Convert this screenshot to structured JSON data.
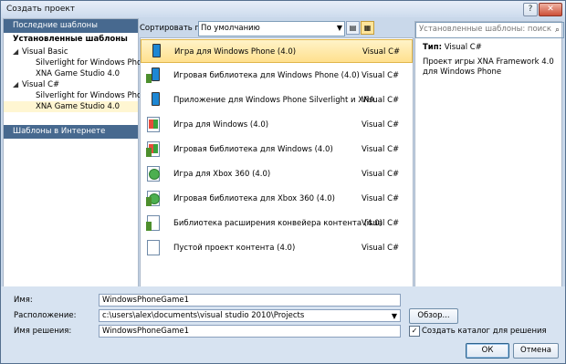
{
  "window": {
    "title": "Создать проект",
    "help": "?",
    "close": "✕"
  },
  "left_panel": {
    "recent": "Последние шаблоны",
    "installed": "Установленные шаблоны",
    "tree": [
      {
        "label": "Visual Basic",
        "children": [
          "Silverlight for Windows Phone",
          "XNA Game Studio 4.0"
        ]
      },
      {
        "label": "Visual C#",
        "children": [
          "Silverlight for Windows Phone",
          "XNA Game Studio 4.0"
        ]
      }
    ],
    "online": "Шаблоны в Интернете"
  },
  "toolbar": {
    "sort_label": "Сортировать по:",
    "sort_value": "По умолчанию"
  },
  "templates": [
    {
      "name": "Игра для Windows Phone (4.0)",
      "lang": "Visual C#",
      "icon": "phone-icon",
      "selected": true
    },
    {
      "name": "Игровая библиотека для Windows Phone (4.0)",
      "lang": "Visual C#",
      "icon": "phone-library-icon"
    },
    {
      "name": "Приложение для Windows Phone Silverlight и XNA",
      "lang": "Visual C#",
      "icon": "phone-app-icon"
    },
    {
      "name": "Игра для Windows (4.0)",
      "lang": "Visual C#",
      "icon": "windows-game-icon"
    },
    {
      "name": "Игровая библиотека для Windows (4.0)",
      "lang": "Visual C#",
      "icon": "windows-library-icon"
    },
    {
      "name": "Игра для Xbox 360 (4.0)",
      "lang": "Visual C#",
      "icon": "xbox-game-icon"
    },
    {
      "name": "Игровая библиотека для Xbox 360 (4.0)",
      "lang": "Visual C#",
      "icon": "xbox-library-icon"
    },
    {
      "name": "Библиотека расширения конвейера контента (4.0)",
      "lang": "Visual C#",
      "icon": "content-pipeline-icon"
    },
    {
      "name": "Пустой проект контента (4.0)",
      "lang": "Visual C#",
      "icon": "content-project-icon"
    }
  ],
  "details": {
    "search_placeholder": "Установленные шаблоны: поиск",
    "type_label": "Тип:",
    "type_value": "Visual C#",
    "description": "Проект игры XNA Framework 4.0 для Windows Phone"
  },
  "form": {
    "name_label": "Имя:",
    "name_value": "WindowsPhoneGame1",
    "location_label": "Расположение:",
    "location_value": "c:\\users\\alex\\documents\\visual studio 2010\\Projects",
    "solution_label": "Имя решения:",
    "solution_value": "WindowsPhoneGame1",
    "browse_label": "Обзор...",
    "create_dir_label": "Создать каталог для решения",
    "create_dir_checked": true,
    "ok_label": "ОК",
    "cancel_label": "Отмена"
  }
}
